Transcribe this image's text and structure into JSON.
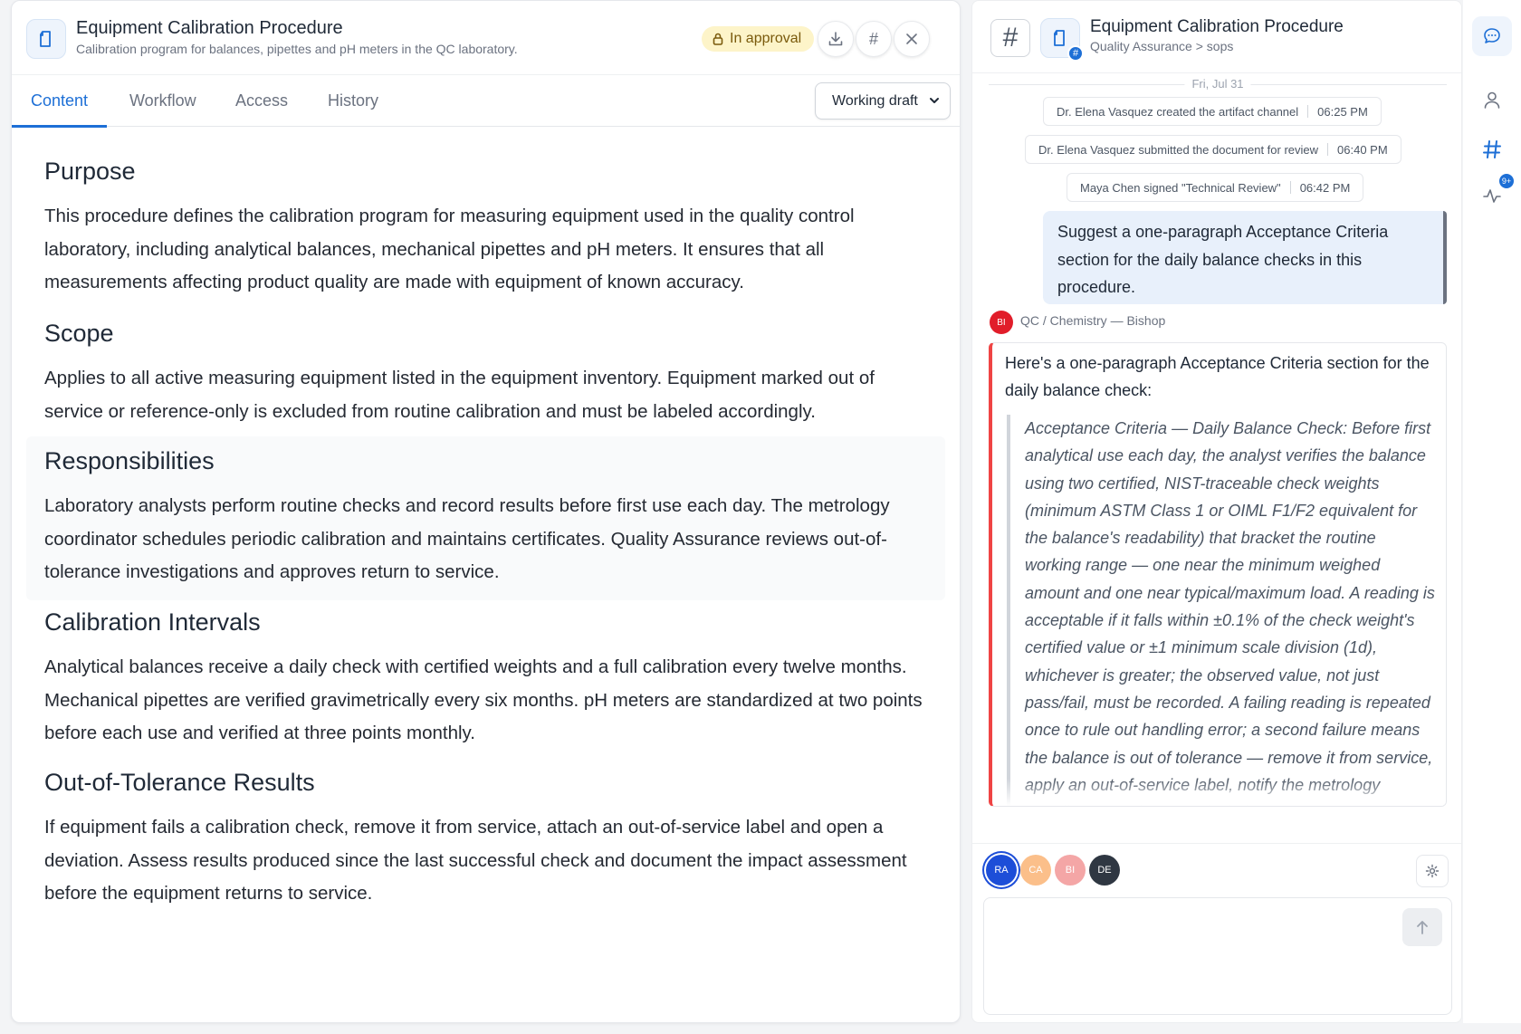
{
  "document": {
    "title": "Equipment Calibration Procedure",
    "subtitle": "Calibration program for balances, pipettes and pH meters in the QC laboratory.",
    "status": "In approval",
    "status_icon": "lock-icon",
    "actions": {
      "download_icon": "download-icon",
      "channel_icon": "#",
      "close_icon": "×"
    }
  },
  "tabs": [
    {
      "label": "Content",
      "active": true
    },
    {
      "label": "Workflow",
      "active": false
    },
    {
      "label": "Access",
      "active": false
    },
    {
      "label": "History",
      "active": false
    }
  ],
  "version_select": {
    "selected": "Working draft"
  },
  "sections": [
    {
      "heading": "Purpose",
      "body": "This procedure defines the calibration program for measuring equipment used in the quality control laboratory, including analytical balances, mechanical pipettes and pH meters. It ensures that all measurements affecting product quality are made with equipment of known accuracy."
    },
    {
      "heading": "Scope",
      "body": "Applies to all active measuring equipment listed in the equipment inventory. Equipment marked out of service or reference-only is excluded from routine calibration and must be labeled accordingly."
    },
    {
      "heading": "Responsibilities",
      "body": "Laboratory analysts perform routine checks and record results before first use each day. The metrology coordinator schedules periodic calibration and maintains certificates. Quality Assurance reviews out-of-tolerance investigations and approves return to service."
    },
    {
      "heading": "Calibration Intervals",
      "body": "Analytical balances receive a daily check with certified weights and a full calibration every twelve months. Mechanical pipettes are verified gravimetrically every six months. pH meters are standardized at two points before each use and verified at three points monthly."
    },
    {
      "heading": "Out-of-Tolerance Results",
      "body": "If equipment fails a calibration check, remove it from service, attach an out-of-service label and open a deviation. Assess results produced since the last successful check and document the impact assessment before the equipment returns to service."
    }
  ],
  "channel": {
    "hash": "#",
    "title": "Equipment Calibration Procedure",
    "breadcrumb": "Quality Assurance > sops",
    "doc_badge": "#",
    "date": "Fri, Jul 31",
    "system_events": [
      {
        "text": "Dr. Elena Vasquez created the artifact channel",
        "time": "06:25 PM"
      },
      {
        "text": "Dr. Elena Vasquez submitted the document for review",
        "time": "06:40 PM"
      },
      {
        "text": "Maya Chen signed \"Technical Review\"",
        "time": "06:42 PM"
      }
    ],
    "user_message": "Suggest a one-paragraph Acceptance Criteria section for the daily balance checks in this procedure.",
    "reply": {
      "avatar": "BI",
      "sender": "QC / Chemistry — Bishop",
      "intro": "Here's a one-paragraph Acceptance Criteria section for the daily balance check:",
      "quote": "Acceptance Criteria — Daily Balance Check: Before first analytical use each day, the analyst verifies the balance using two certified, NIST-traceable check weights (minimum ASTM Class 1 or OIML F1/F2 equivalent for the balance's readability) that bracket the routine working range — one near the minimum weighed amount and one near typical/maximum load. A reading is acceptable if it falls within ±0.1% of the check weight's certified value or ±1 minimum scale division (1d), whichever is greater; the observed value, not just pass/fail, must be recorded. A failing reading is repeated once to rule out handling error; a second failure means the balance is out of tolerance — remove it from service, apply an out-of-service label, notify the metrology coordinator, and open a deviation."
    },
    "participants": [
      {
        "initials": "RA",
        "color": "#1d4ed8"
      },
      {
        "initials": "CA",
        "color": "#fbbf8a"
      },
      {
        "initials": "BI",
        "color": "#f4a6a6"
      },
      {
        "initials": "DE",
        "color": "#2f3742"
      }
    ],
    "composer": {
      "placeholder": "",
      "send_icon": "arrow-up-icon",
      "settings_icon": "gear-icon"
    }
  },
  "rail": {
    "items": [
      {
        "icon": "chat-icon",
        "active": true
      },
      {
        "icon": "user-icon",
        "active": false
      },
      {
        "icon": "hash-icon",
        "active": true
      },
      {
        "icon": "activity-icon",
        "active": false
      }
    ],
    "badge": "9+"
  }
}
